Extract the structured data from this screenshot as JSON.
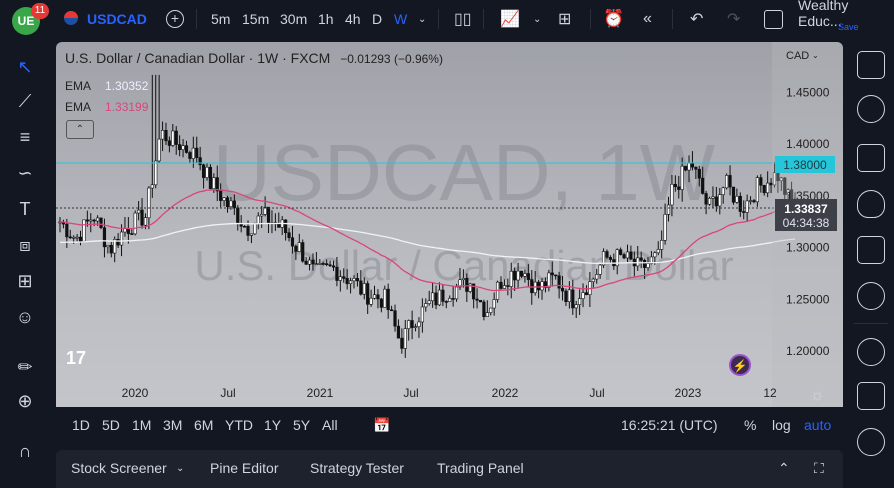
{
  "topbar": {
    "logo": "UE",
    "notifications": "11",
    "symbol": "USDCAD",
    "intervals": [
      "5m",
      "15m",
      "30m",
      "1h",
      "4h",
      "D",
      "W"
    ],
    "active_interval": "W",
    "account": "Wealthy Educ...",
    "save": "Save"
  },
  "chart": {
    "title": "U.S. Dollar / Canadian Dollar",
    "interval": "1W",
    "source": "FXCM",
    "change": "−0.01293 (−0.96%)",
    "watermark_main": "USDCAD, 1W",
    "watermark_sub": "U.S. Dollar / Canadian Dollar",
    "ema": [
      {
        "label": "EMA",
        "value": "1.30352",
        "color": "#e0e3eb"
      },
      {
        "label": "EMA",
        "value": "1.33199",
        "color": "#d8467a"
      }
    ],
    "currency": "CAD",
    "price_ticks": [
      "1.45000",
      "1.40000",
      "1.35000",
      "1.30000",
      "1.25000",
      "1.20000"
    ],
    "time_ticks": [
      "2020",
      "Jul",
      "2021",
      "Jul",
      "2022",
      "Jul",
      "2023",
      "12"
    ],
    "horizontal_line": {
      "label": "1.38000",
      "color": "#26c6da"
    },
    "last_price": "1.33837",
    "countdown": "04:34:38"
  },
  "chart_data": {
    "type": "candlestick",
    "ylim": [
      1.18,
      1.48
    ],
    "start": "2019-09",
    "monthly_close": [
      1.325,
      1.31,
      1.33,
      1.3,
      1.32,
      1.33,
      1.41,
      1.4,
      1.39,
      1.36,
      1.34,
      1.32,
      1.33,
      1.32,
      1.3,
      1.275,
      1.28,
      1.27,
      1.255,
      1.25,
      1.21,
      1.235,
      1.25,
      1.26,
      1.265,
      1.24,
      1.27,
      1.28,
      1.26,
      1.27,
      1.25,
      1.265,
      1.29,
      1.29,
      1.28,
      1.29,
      1.36,
      1.38,
      1.34,
      1.36,
      1.34,
      1.36,
      1.37,
      1.338
    ]
  },
  "bottombar": {
    "ranges": [
      "1D",
      "5D",
      "1M",
      "3M",
      "6M",
      "YTD",
      "1Y",
      "5Y",
      "All"
    ],
    "time": "16:25:21 (UTC)",
    "percent": "%",
    "log": "log",
    "auto": "auto"
  },
  "panel": {
    "tabs": [
      "Stock Screener",
      "Pine Editor",
      "Strategy Tester",
      "Trading Panel"
    ]
  }
}
